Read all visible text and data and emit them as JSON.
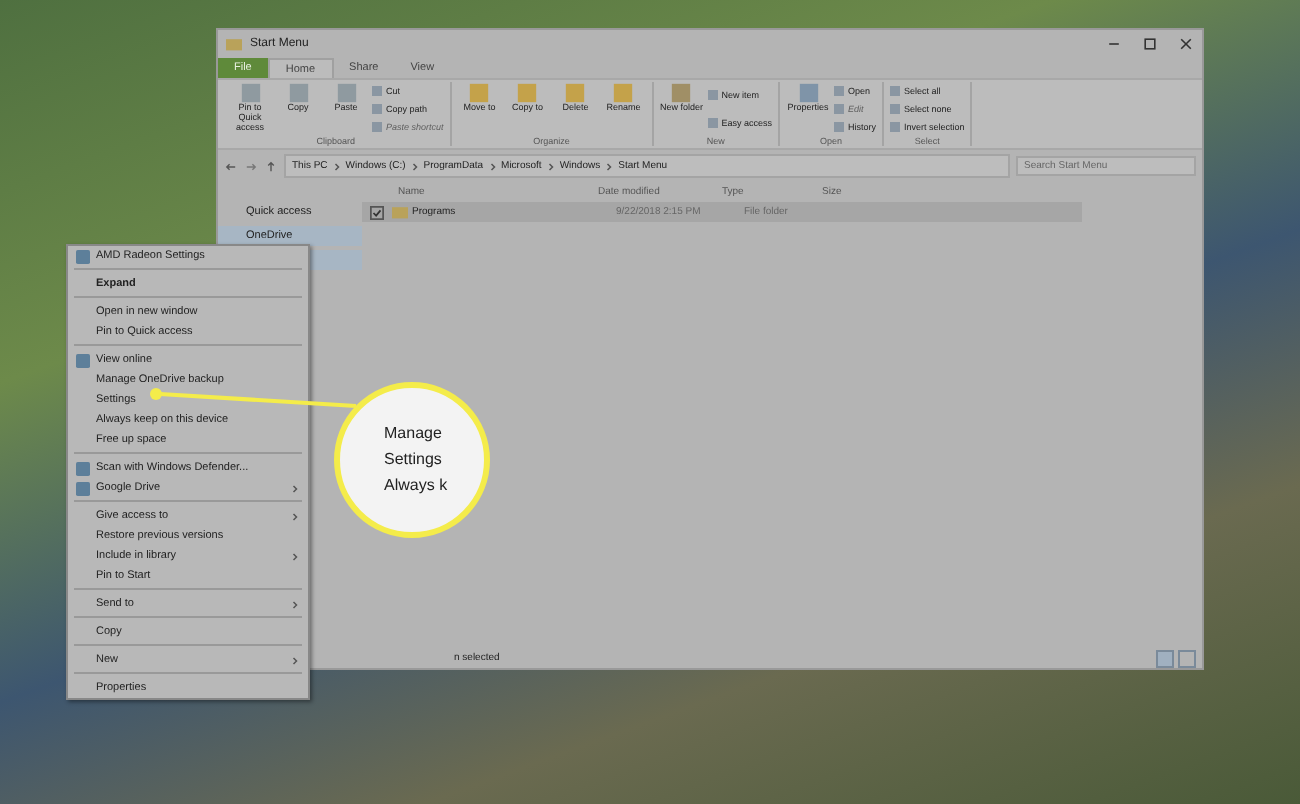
{
  "window": {
    "title": "Start Menu"
  },
  "ribbon_tabs": [
    {
      "label": "File",
      "selected": false,
      "kind": "file"
    },
    {
      "label": "Home",
      "selected": true,
      "kind": "tab"
    },
    {
      "label": "Share",
      "selected": false,
      "kind": "tab"
    },
    {
      "label": "View",
      "selected": false,
      "kind": "tab"
    }
  ],
  "ribbon_groups": [
    {
      "name": "Clipboard",
      "large": [
        "Pin to Quick access",
        "Copy",
        "Paste"
      ],
      "small": [
        {
          "label": "Cut",
          "disabled": false
        },
        {
          "label": "Copy path",
          "disabled": false
        },
        {
          "label": "Paste shortcut",
          "disabled": true
        }
      ]
    },
    {
      "name": "Organize",
      "large": [
        "Move to",
        "Copy to",
        "Delete",
        "Rename"
      ]
    },
    {
      "name": "New",
      "large": [
        "New folder"
      ],
      "small": [
        {
          "label": "New item",
          "disabled": false
        },
        {
          "label": "Easy access",
          "disabled": false
        }
      ]
    },
    {
      "name": "Open",
      "large": [
        "Properties"
      ],
      "small": [
        {
          "label": "Open",
          "disabled": false
        },
        {
          "label": "Edit",
          "disabled": true
        },
        {
          "label": "History",
          "disabled": false
        }
      ]
    },
    {
      "name": "Select",
      "small": [
        {
          "label": "Select all",
          "disabled": false
        },
        {
          "label": "Select none",
          "disabled": false
        },
        {
          "label": "Invert selection",
          "disabled": false
        }
      ]
    }
  ],
  "address": {
    "crumbs": [
      "This PC",
      "Windows (C:)",
      "ProgramData",
      "Microsoft",
      "Windows",
      "Start Menu"
    ],
    "search": {
      "placeholder": "Search Start Menu"
    }
  },
  "nav": [
    {
      "label": "Quick access",
      "selected": false
    },
    {
      "label": "OneDrive",
      "selected": true
    }
  ],
  "table": {
    "columns": [
      "Name",
      "Date modified",
      "Type",
      "Size"
    ],
    "rows": [
      {
        "cells": [
          "Programs",
          "9/22/2018 2:15 PM",
          "File folder",
          ""
        ],
        "selected": true,
        "checked": true
      }
    ]
  },
  "status_bar": "n selected",
  "context_menu": [
    {
      "kind": "item",
      "label": "AMD Radeon Settings",
      "icon": true,
      "submenu": false,
      "bold": false
    },
    {
      "kind": "separator"
    },
    {
      "kind": "item",
      "label": "Expand",
      "icon": false,
      "submenu": false,
      "bold": true
    },
    {
      "kind": "separator"
    },
    {
      "kind": "item",
      "label": "Open in new window",
      "icon": false,
      "submenu": false,
      "bold": false
    },
    {
      "kind": "item",
      "label": "Pin to Quick access",
      "icon": false,
      "submenu": false,
      "bold": false
    },
    {
      "kind": "separator"
    },
    {
      "kind": "item",
      "label": "View online",
      "icon": true,
      "submenu": false,
      "bold": false
    },
    {
      "kind": "item",
      "label": "Manage OneDrive backup",
      "icon": false,
      "submenu": false,
      "bold": false
    },
    {
      "kind": "item",
      "label": "Settings",
      "icon": false,
      "submenu": false,
      "bold": false
    },
    {
      "kind": "item",
      "label": "Always keep on this device",
      "icon": false,
      "submenu": false,
      "bold": false
    },
    {
      "kind": "item",
      "label": "Free up space",
      "icon": false,
      "submenu": false,
      "bold": false
    },
    {
      "kind": "separator"
    },
    {
      "kind": "item",
      "label": "Scan with Windows Defender...",
      "icon": true,
      "submenu": false,
      "bold": false
    },
    {
      "kind": "item",
      "label": "Google Drive",
      "icon": true,
      "submenu": true,
      "bold": false
    },
    {
      "kind": "separator"
    },
    {
      "kind": "item",
      "label": "Give access to",
      "icon": false,
      "submenu": true,
      "bold": false
    },
    {
      "kind": "item",
      "label": "Restore previous versions",
      "icon": false,
      "submenu": false,
      "bold": false
    },
    {
      "kind": "item",
      "label": "Include in library",
      "icon": false,
      "submenu": true,
      "bold": false
    },
    {
      "kind": "item",
      "label": "Pin to Start",
      "icon": false,
      "submenu": false,
      "bold": false
    },
    {
      "kind": "separator"
    },
    {
      "kind": "item",
      "label": "Send to",
      "icon": false,
      "submenu": true,
      "bold": false
    },
    {
      "kind": "separator"
    },
    {
      "kind": "item",
      "label": "Copy",
      "icon": false,
      "submenu": false,
      "bold": false
    },
    {
      "kind": "separator"
    },
    {
      "kind": "item",
      "label": "New",
      "icon": false,
      "submenu": true,
      "bold": false
    },
    {
      "kind": "separator"
    },
    {
      "kind": "item",
      "label": "Properties",
      "icon": false,
      "submenu": false,
      "bold": false
    }
  ],
  "magnifier": {
    "lines": [
      "Manage",
      "Settings",
      "Always k"
    ]
  }
}
